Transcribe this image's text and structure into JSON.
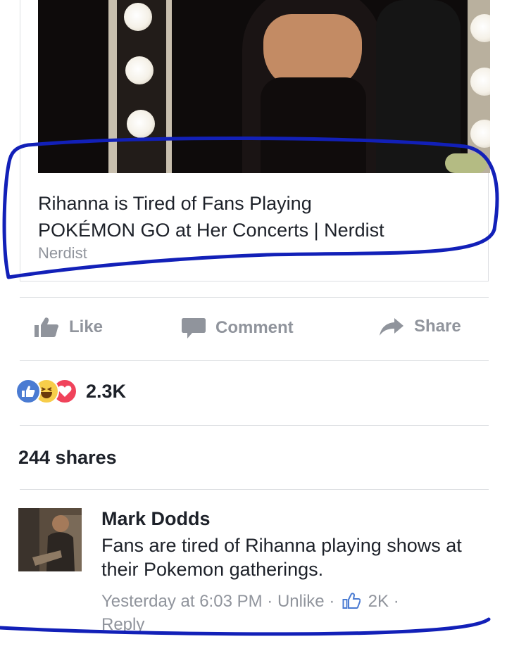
{
  "card": {
    "title_line1": "Rihanna is Tired of Fans Playing",
    "title_line2": "POKÉMON GO at Her Concerts | Nerdist",
    "source": "Nerdist"
  },
  "actions": {
    "like": "Like",
    "comment": "Comment",
    "share": "Share"
  },
  "reactions": {
    "types": [
      "like",
      "haha",
      "love"
    ],
    "count": "2.3K"
  },
  "shares": "244 shares",
  "comment": {
    "author": "Mark Dodds",
    "text": "Fans are tired of Rihanna playing shows at their Pokemon gatherings.",
    "time": "Yesterday at 6:03 PM",
    "unlike": "Unlike",
    "likes": "2K",
    "reply": "Reply"
  },
  "colors": {
    "marker": "#1220b8",
    "meta_gray": "#90949c",
    "like_blue": "#4a7bd2"
  }
}
